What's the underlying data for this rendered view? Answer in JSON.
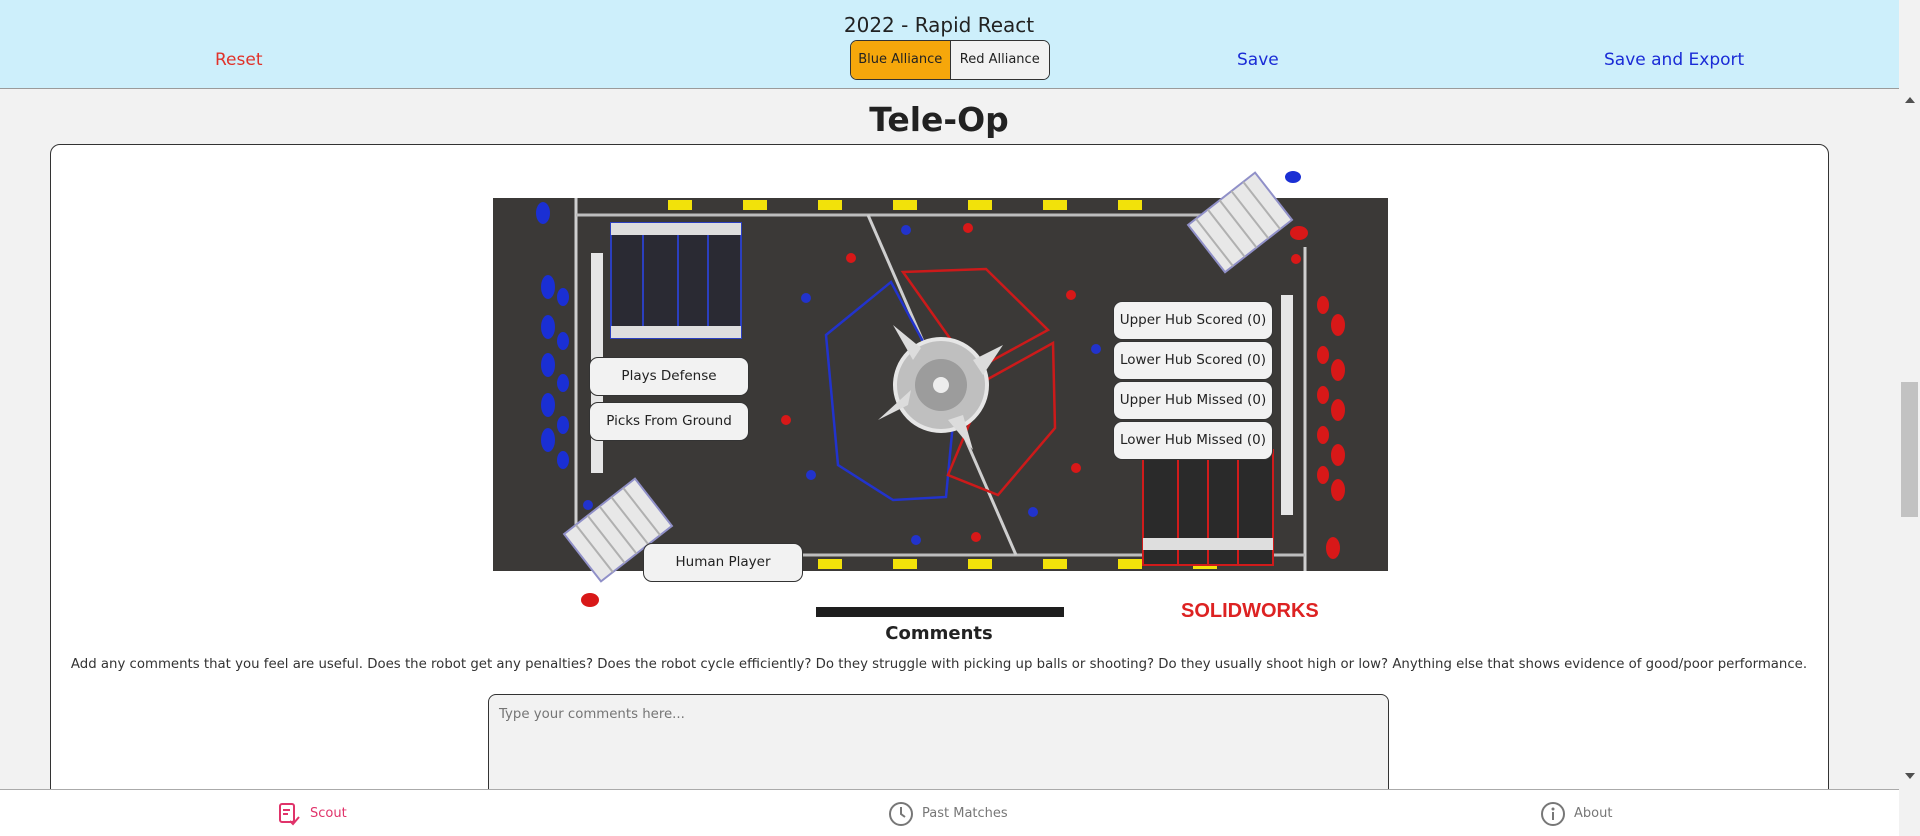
{
  "header": {
    "title": "2022 - Rapid React",
    "reset_label": "Reset",
    "save_label": "Save",
    "save_export_label": "Save and Export",
    "alliance": {
      "blue_label": "Blue Alliance",
      "red_label": "Red Alliance",
      "selected": "Blue Alliance"
    }
  },
  "main": {
    "title": "Tele-Op",
    "field_buttons": {
      "plays_defense": "Plays Defense",
      "picks_from_ground": "Picks From Ground",
      "human_player": "Human Player",
      "upper_hub_scored": "Upper Hub Scored (0)",
      "lower_hub_scored": "Lower Hub Scored (0)",
      "upper_hub_missed": "Upper Hub Missed (0)",
      "lower_hub_missed": "Lower Hub Missed (0)"
    },
    "field_logo_text": "SOLIDWORKS",
    "comments": {
      "title": "Comments",
      "description": "Add any comments that you feel are useful. Does the robot get any penalties? Does the robot cycle efficiently? Do they struggle with picking up balls or shooting? Do they usually shoot high or low? Anything else that shows evidence of good/poor performance.",
      "placeholder": "Type your comments here...",
      "value": ""
    }
  },
  "bottom_nav": {
    "items": [
      {
        "label": "Scout",
        "icon": "clipboard-check-icon",
        "active": true
      },
      {
        "label": "Past Matches",
        "icon": "clock-icon",
        "active": false
      },
      {
        "label": "About",
        "icon": "info-circle-icon",
        "active": false
      }
    ]
  },
  "colors": {
    "header_bg": "#cdeffb",
    "reset": "#e0322a",
    "link": "#1a2bd6",
    "alliance_selected": "#f6a70b",
    "nav_active": "#e0336a",
    "field_bg": "#3b3937"
  }
}
